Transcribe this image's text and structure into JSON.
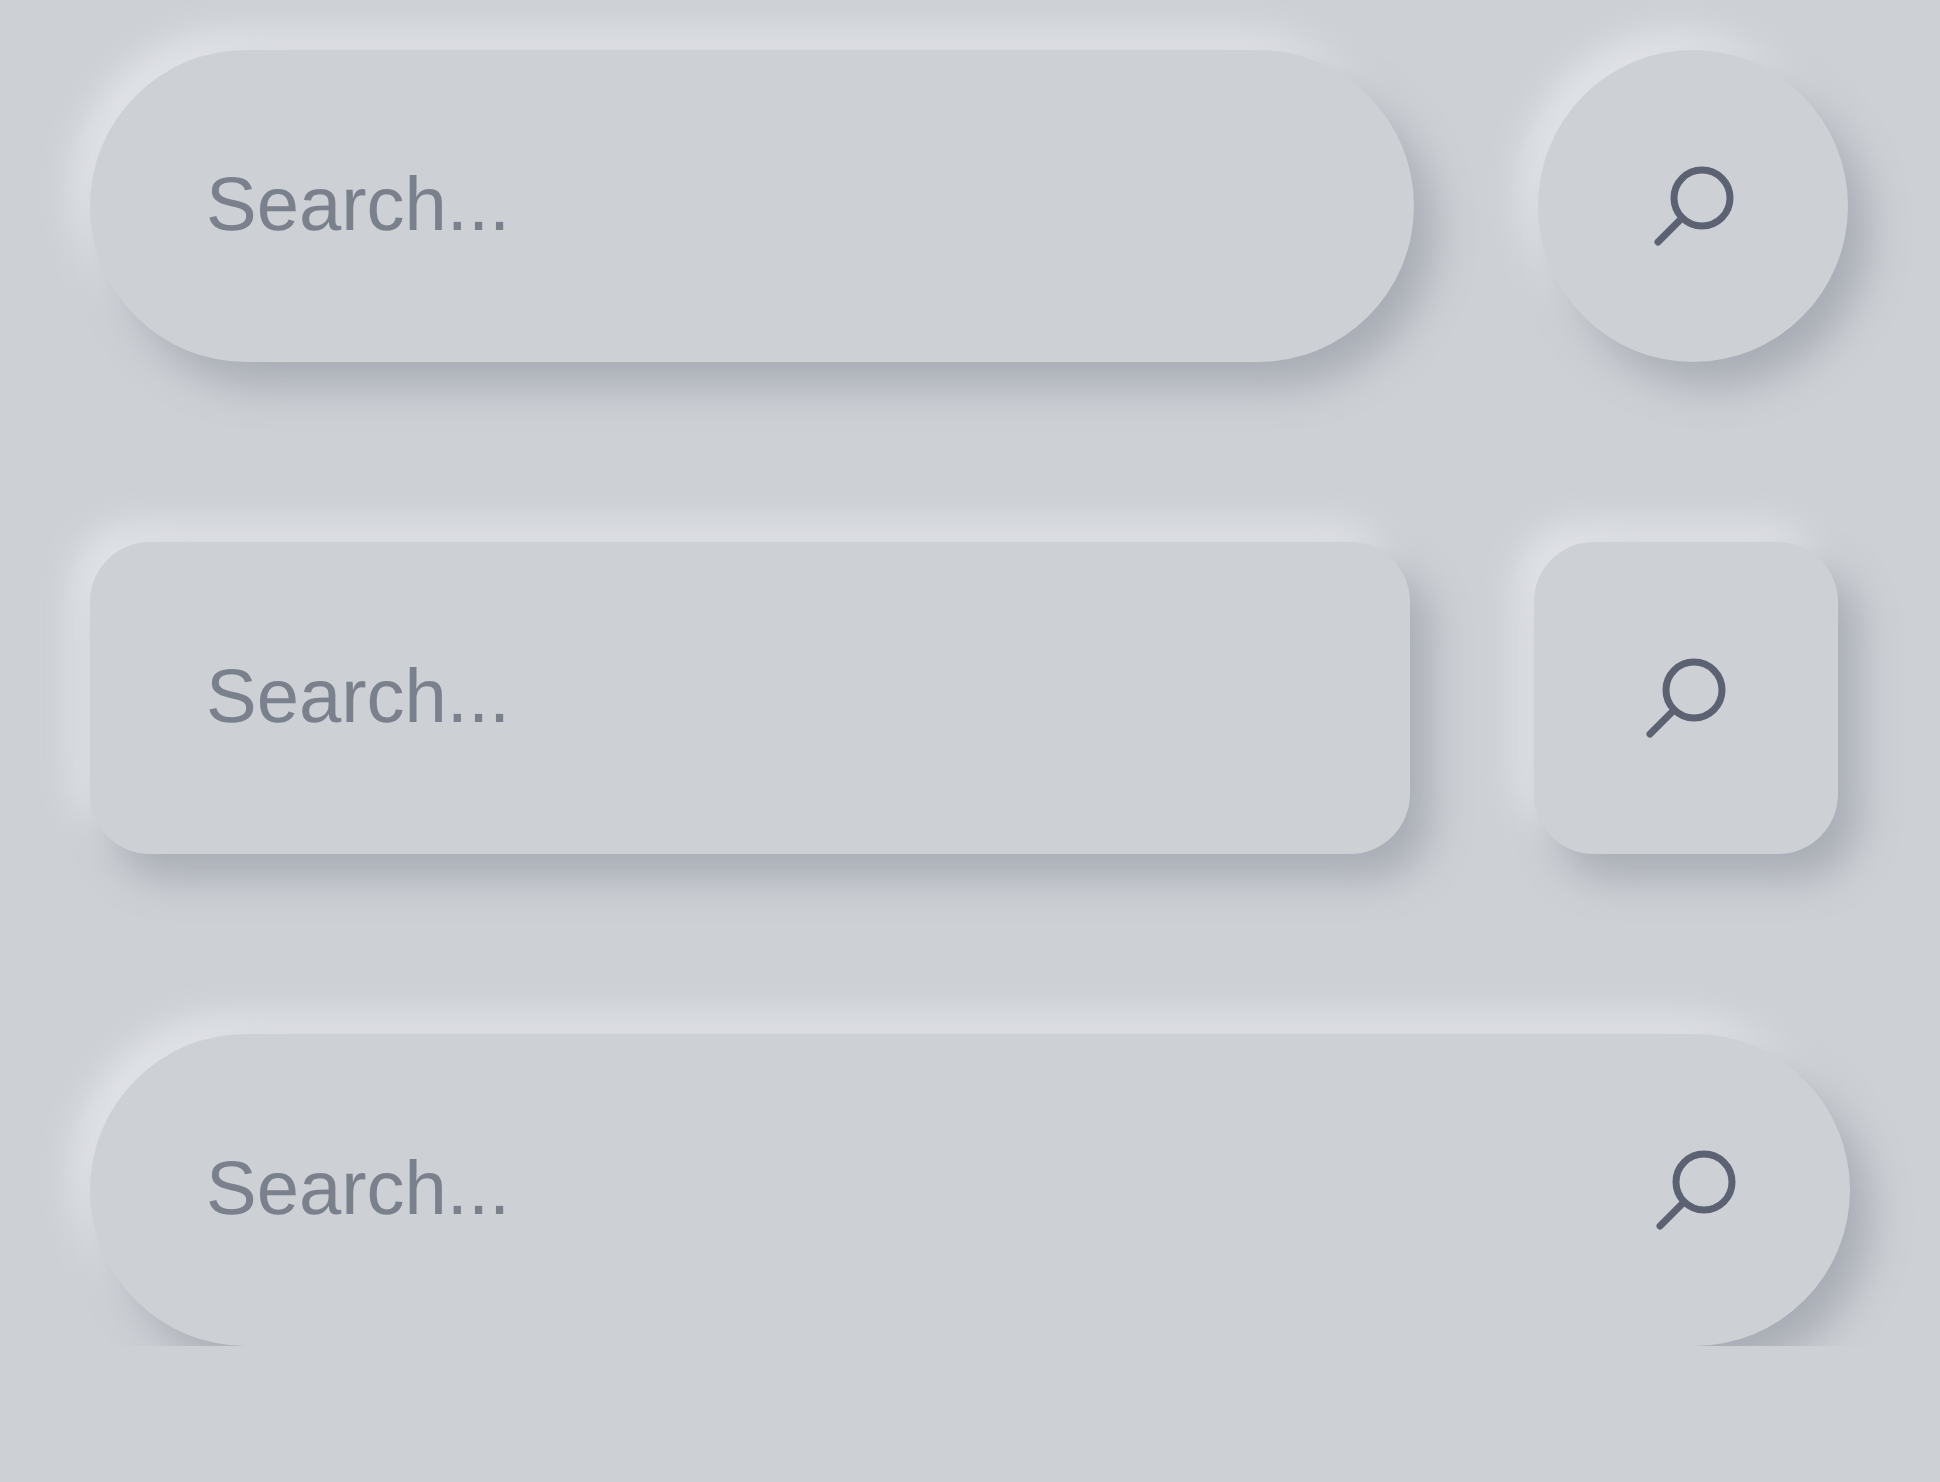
{
  "search_bars": [
    {
      "kind": "pill-circle",
      "placeholder": "Search..."
    },
    {
      "kind": "rounded-square",
      "placeholder": "Search..."
    },
    {
      "kind": "pill-inline",
      "placeholder": "Search..."
    }
  ]
}
